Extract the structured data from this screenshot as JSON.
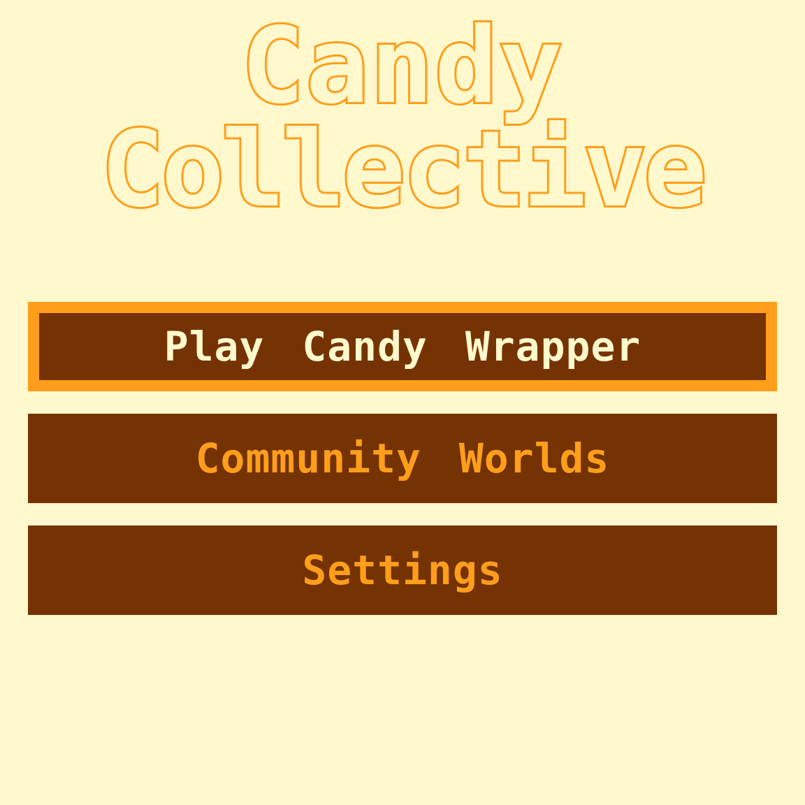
{
  "title": {
    "line1": "Candy",
    "line2": "Collective"
  },
  "menu": {
    "items": [
      {
        "label": "Play Candy Wrapper",
        "selected": true
      },
      {
        "label": "Community Worlds",
        "selected": false
      },
      {
        "label": "Settings",
        "selected": false
      }
    ]
  },
  "colors": {
    "background": "#FFF8CC",
    "accent": "#FF9E1B",
    "button": "#753304",
    "selected_text": "#FFF8CC"
  }
}
